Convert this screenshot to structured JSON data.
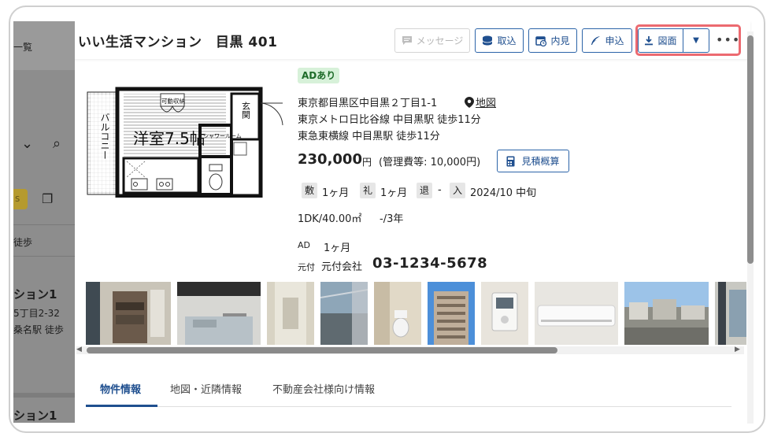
{
  "background_page": {
    "texts": [
      "一覧",
      "s",
      "徒歩",
      "ション1",
      "5丁目2-32",
      "桑名駅 徒歩",
      "ション1"
    ]
  },
  "header": {
    "title": "いい生活マンション　目黒 401",
    "buttons": {
      "message": "メッセージ",
      "torikomi": "取込",
      "naiken": "内見",
      "moushikomi": "申込",
      "zumen": "図面"
    }
  },
  "floorplan": {
    "room_label": "洋室7.5帖",
    "balcony_label": "バルコニー",
    "storage_label": "可動収納",
    "entrance_label": "玄関",
    "shower_label": "シャワールーム"
  },
  "property": {
    "ad_badge": "ADあり",
    "address": "東京都目黒区中目黒２丁目1-1",
    "map_link": "地図",
    "access": [
      "東京メトロ日比谷線 中目黒駅 徒歩11分",
      "東急東横線 中目黒駅 徒歩11分"
    ],
    "rent": "230,000",
    "rent_unit": "円",
    "management_fee": "(管理費等: 10,000円)",
    "estimate_button": "見積概算",
    "deposit_label": "敷",
    "deposit": "1ヶ月",
    "key_money_label": "礼",
    "key_money": "1ヶ月",
    "move_out_label": "退",
    "move_out": "-",
    "move_in_label": "入",
    "move_in": "2024/10 中旬",
    "layout_size": "1DK/40.00㎡",
    "age": "-/3年",
    "ad_label": "AD",
    "ad_value": "1ヶ月",
    "motozuke_label": "元付",
    "motozuke_company": "元付会社",
    "phone": "03-1234-5678"
  },
  "tabs": [
    "物件情報",
    "地図・近隣情報",
    "不動産会社様向け情報"
  ],
  "colors": {
    "accent": "#1f4f8f",
    "highlight": "#ec6a70",
    "ad_badge_bg": "#d7f1d9",
    "ad_badge_text": "#1d6b28"
  }
}
